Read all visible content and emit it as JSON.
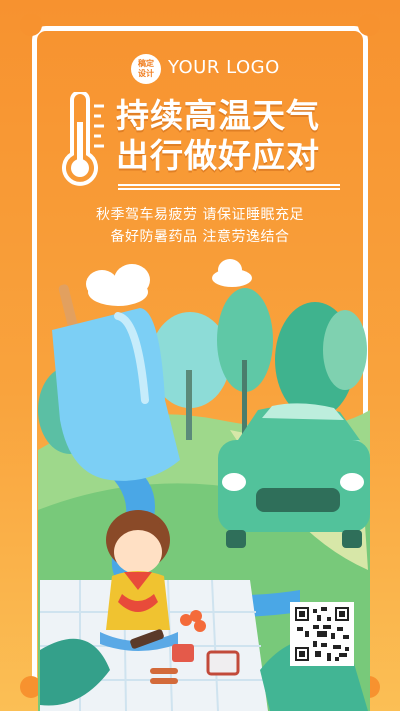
{
  "logo": {
    "badge_line1": "稿定",
    "badge_line2": "设计",
    "text": "YOUR LOGO"
  },
  "headline": {
    "line1": "持续高温天气",
    "line2": "出行做好应对"
  },
  "tips": {
    "line1": "秋季驾车易疲劳 请保证睡眠充足",
    "line2": "备好防暑药品 注意劳逸结合"
  },
  "icons": {
    "thermometer": "thermometer-icon",
    "qr": "qr-code"
  },
  "colors": {
    "background": "#f7922f",
    "accent": "#ffffff",
    "car": "#52c29b",
    "river": "#4aa7e6",
    "popsicle": "#7ccff5"
  }
}
